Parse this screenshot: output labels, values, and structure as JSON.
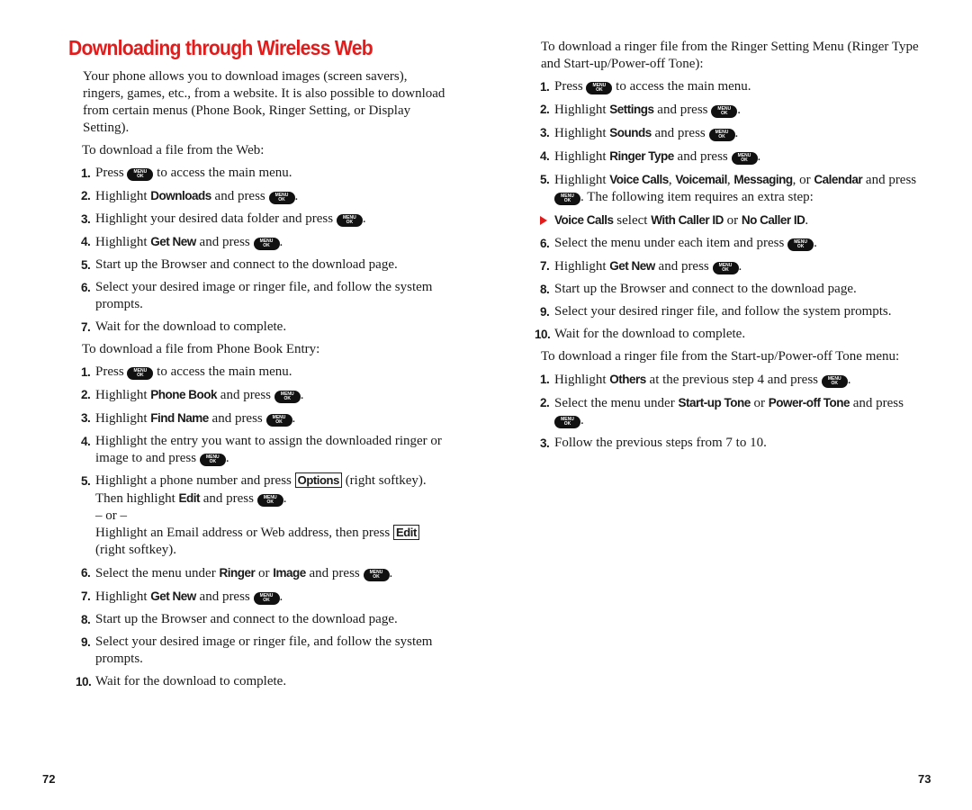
{
  "colors": {
    "accent": "#e41b1b",
    "text": "#1a1a1a",
    "key_bg": "#111111"
  },
  "icons": {
    "menu_ok_key": {
      "name": "menu-ok-key-icon",
      "top": "MENU",
      "bottom": "OK"
    },
    "bullet": "red-triangle-arrow-icon"
  },
  "left_page": {
    "title": "Downloading through Wireless Web",
    "intro": "Your phone allows you to download images (screen savers), ringers, games, etc., from a website. It is also possible to download from certain menus (Phone Book, Ringer Setting, or Display Setting).",
    "section_web": {
      "lead": "To download a file from the Web:",
      "steps": [
        {
          "num": "1.",
          "pre": "Press",
          "post": "to access the main menu."
        },
        {
          "num": "2.",
          "pre": "Highlight",
          "bold": "Downloads",
          "mid": "and press",
          "post": "."
        },
        {
          "num": "3.",
          "pre": "Highlight your desired data folder and press",
          "post": "."
        },
        {
          "num": "4.",
          "pre": "Highlight",
          "bold": "Get New",
          "mid": "and press",
          "post": "."
        },
        {
          "num": "5.",
          "text": "Start up the Browser and connect to the download page."
        },
        {
          "num": "6.",
          "text": "Select your desired image or ringer file, and follow the system prompts."
        },
        {
          "num": "7.",
          "text": "Wait for the download to complete."
        }
      ]
    },
    "section_phonebook": {
      "lead": "To download a file from Phone Book Entry:",
      "steps": [
        {
          "num": "1.",
          "pre": "Press",
          "post": "to access the main menu."
        },
        {
          "num": "2.",
          "pre": "Highlight",
          "bold": "Phone Book",
          "mid": "and press",
          "post": "."
        },
        {
          "num": "3.",
          "pre": "Highlight",
          "bold": "Find Name",
          "mid": "and press",
          "post": "."
        },
        {
          "num": "4.",
          "pre": "Highlight the entry you want to assign the downloaded ringer or image to and press",
          "post": "."
        },
        {
          "num": "5.",
          "pre": "Highlight a phone number and press",
          "softkey": "Options",
          "post": "(right softkey).",
          "line2_pre": "Then highlight",
          "line2_bold": "Edit",
          "line2_mid": "and press",
          "line2_post": ".",
          "or": "– or –",
          "alt_pre": "Highlight an Email address or Web address, then press",
          "alt_softkey": "Edit",
          "alt_post": "(right softkey)."
        },
        {
          "num": "6.",
          "pre": "Select the menu under",
          "bold": "Ringer",
          "mid1": "or",
          "bold2": "Image",
          "mid": "and press",
          "post": "."
        },
        {
          "num": "7.",
          "pre": "Highlight",
          "bold": "Get New",
          "mid": "and press",
          "post": "."
        },
        {
          "num": "8.",
          "text": "Start up the Browser and connect to the download page."
        },
        {
          "num": "9.",
          "text": "Select your desired image or ringer file, and follow the system prompts."
        },
        {
          "num": "10.",
          "text": "Wait for the download to complete."
        }
      ]
    },
    "page_number": "72"
  },
  "right_page": {
    "section_ringer": {
      "lead": "To download a ringer file from the Ringer Setting Menu (Ringer Type and Start-up/Power-off Tone):",
      "steps": [
        {
          "num": "1.",
          "pre": "Press",
          "post": "to access the main menu."
        },
        {
          "num": "2.",
          "pre": "Highlight",
          "bold": "Settings",
          "mid": "and press",
          "post": "."
        },
        {
          "num": "3.",
          "pre": "Highlight",
          "bold": "Sounds",
          "mid": "and press",
          "post": "."
        },
        {
          "num": "4.",
          "pre": "Highlight",
          "bold": "Ringer Type",
          "mid": "and press",
          "post": "."
        },
        {
          "num": "5.",
          "pre": "Highlight",
          "bold": "Voice Calls",
          "sep1": ",",
          "bold2": "Voicemail",
          "sep2": ",",
          "bold3": "Messaging",
          "sep3": ", or",
          "bold4": "Calendar",
          "mid": "and press",
          "post": ". The following item requires an extra step:"
        },
        {
          "num": "6.",
          "pre": "Select the menu under each item and press",
          "post": "."
        },
        {
          "num": "7.",
          "pre": "Highlight",
          "bold": "Get New",
          "mid": "and press",
          "post": "."
        },
        {
          "num": "8.",
          "text": "Start up the Browser and connect to the download page."
        },
        {
          "num": "9.",
          "text": "Select your desired ringer file, and follow the system prompts."
        },
        {
          "num": "10.",
          "text": "Wait for the download to complete."
        }
      ],
      "sub_bullet": {
        "bold": "Voice Calls",
        "mid": "select",
        "bold2": "With Caller ID",
        "mid2": "or",
        "bold3": "No Caller ID",
        "post": "."
      }
    },
    "section_tone": {
      "lead": "To download a ringer file from the Start-up/Power-off Tone menu:",
      "steps": [
        {
          "num": "1.",
          "pre": "Highlight",
          "bold": "Others",
          "mid": "at the previous step 4 and press",
          "post": "."
        },
        {
          "num": "2.",
          "pre": "Select the menu under",
          "bold": "Start-up Tone",
          "mid1": "or",
          "bold2": "Power-off Tone",
          "mid": "and press",
          "post": "."
        },
        {
          "num": "3.",
          "text": "Follow the previous steps from 7 to 10."
        }
      ]
    },
    "page_number": "73"
  }
}
